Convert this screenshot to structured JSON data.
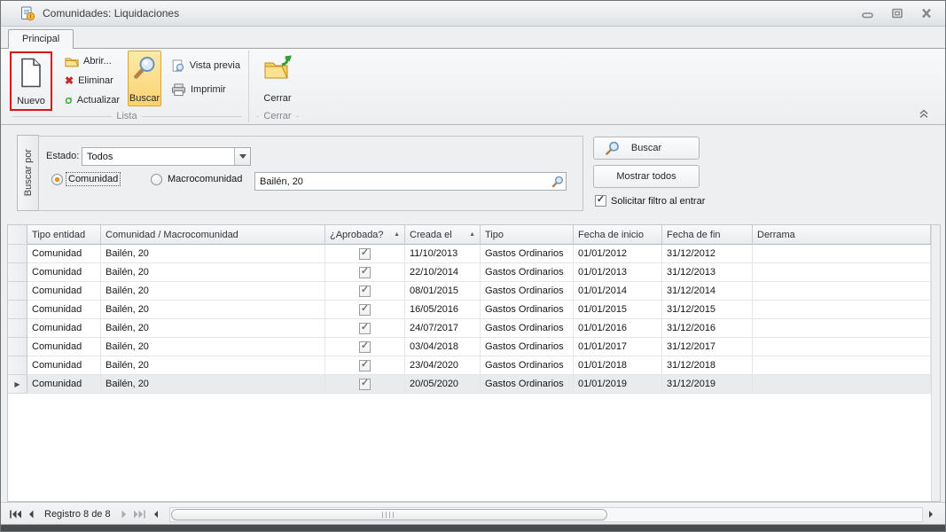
{
  "window": {
    "title": "Comunidades: Liquidaciones"
  },
  "ribbon": {
    "tab_label": "Principal",
    "nuevo_label": "Nuevo",
    "abrir_label": "Abrir...",
    "eliminar_label": "Eliminar",
    "actualizar_label": "Actualizar",
    "buscar_label": "Buscar",
    "vista_previa_label": "Vista previa",
    "imprimir_label": "Imprimir",
    "cerrar_label": "Cerrar",
    "group_lista_label": "Lista",
    "group_cerrar_label": "Cerrar"
  },
  "filter": {
    "side_tab_label": "Buscar por",
    "estado_label": "Estado:",
    "estado_value": "Todos",
    "comunidad_label": "Comunidad",
    "macrocomunidad_label": "Macrocomunidad",
    "search_value": "Bailén, 20",
    "buscar_button_label": "Buscar",
    "mostrar_todos_label": "Mostrar todos",
    "solicitar_label": "Solicitar filtro al entrar"
  },
  "grid": {
    "columns": [
      {
        "label": "Tipo entidad",
        "sorted": false
      },
      {
        "label": "Comunidad / Macrocomunidad",
        "sorted": false
      },
      {
        "label": "¿Aprobada?",
        "sorted": true
      },
      {
        "label": "Creada el",
        "sorted": true
      },
      {
        "label": "Tipo",
        "sorted": false
      },
      {
        "label": "Fecha de inicio",
        "sorted": false
      },
      {
        "label": "Fecha de fin",
        "sorted": false
      },
      {
        "label": "Derrama",
        "sorted": false
      }
    ],
    "rows": [
      {
        "tipo_entidad": "Comunidad",
        "comunidad": "Bailén, 20",
        "aprobada": true,
        "creada_el": "11/10/2013",
        "tipo": "Gastos Ordinarios",
        "fecha_inicio": "01/01/2012",
        "fecha_fin": "31/12/2012",
        "derrama": ""
      },
      {
        "tipo_entidad": "Comunidad",
        "comunidad": "Bailén, 20",
        "aprobada": true,
        "creada_el": "22/10/2014",
        "tipo": "Gastos Ordinarios",
        "fecha_inicio": "01/01/2013",
        "fecha_fin": "31/12/2013",
        "derrama": ""
      },
      {
        "tipo_entidad": "Comunidad",
        "comunidad": "Bailén, 20",
        "aprobada": true,
        "creada_el": "08/01/2015",
        "tipo": "Gastos Ordinarios",
        "fecha_inicio": "01/01/2014",
        "fecha_fin": "31/12/2014",
        "derrama": ""
      },
      {
        "tipo_entidad": "Comunidad",
        "comunidad": "Bailén, 20",
        "aprobada": true,
        "creada_el": "16/05/2016",
        "tipo": "Gastos Ordinarios",
        "fecha_inicio": "01/01/2015",
        "fecha_fin": "31/12/2015",
        "derrama": ""
      },
      {
        "tipo_entidad": "Comunidad",
        "comunidad": "Bailén, 20",
        "aprobada": true,
        "creada_el": "24/07/2017",
        "tipo": "Gastos Ordinarios",
        "fecha_inicio": "01/01/2016",
        "fecha_fin": "31/12/2016",
        "derrama": ""
      },
      {
        "tipo_entidad": "Comunidad",
        "comunidad": "Bailén, 20",
        "aprobada": true,
        "creada_el": "03/04/2018",
        "tipo": "Gastos Ordinarios",
        "fecha_inicio": "01/01/2017",
        "fecha_fin": "31/12/2017",
        "derrama": ""
      },
      {
        "tipo_entidad": "Comunidad",
        "comunidad": "Bailén, 20",
        "aprobada": true,
        "creada_el": "23/04/2020",
        "tipo": "Gastos Ordinarios",
        "fecha_inicio": "01/01/2018",
        "fecha_fin": "31/12/2018",
        "derrama": ""
      },
      {
        "tipo_entidad": "Comunidad",
        "comunidad": "Bailén, 20",
        "aprobada": true,
        "creada_el": "20/05/2020",
        "tipo": "Gastos Ordinarios",
        "fecha_inicio": "01/01/2019",
        "fecha_fin": "31/12/2019",
        "derrama": ""
      }
    ],
    "selected_row_index": 7
  },
  "statusbar": {
    "record_label": "Registro 8 de 8"
  },
  "icons": {
    "sort_asc": "▲",
    "row_pointer": "▶",
    "check": "✓",
    "delete_glyph": "✖"
  },
  "accents": {
    "annotation_red": "#e01010",
    "ribbon_selected": "#f9d470",
    "radio_dot": "#f6a61e"
  }
}
